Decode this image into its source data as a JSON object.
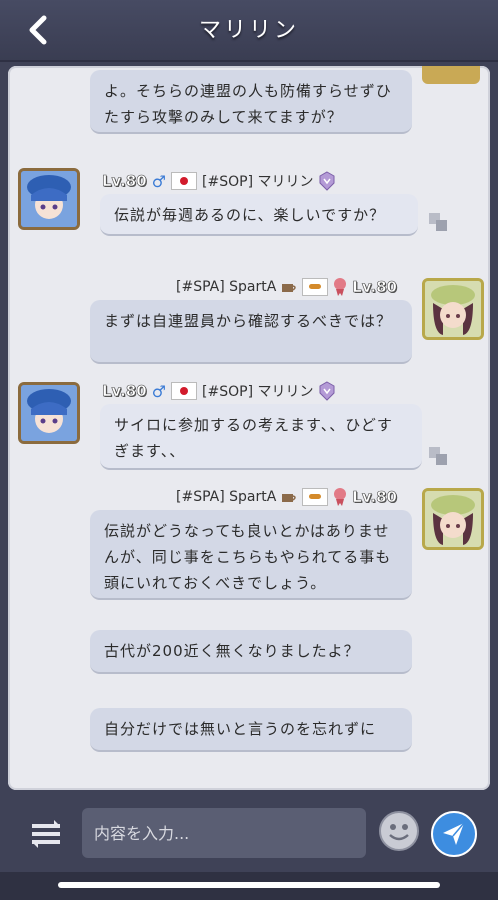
{
  "header": {
    "title": "マリリン"
  },
  "messages": [
    {
      "text": "よ。そちらの連盟の人も防備すらせずひたすら攻撃のみして来てますが？"
    },
    {
      "level": "Lv.80",
      "gender": "♂",
      "name": "[#SOP] マリリン",
      "text": "伝説が毎週あるのに、楽しいですか？"
    },
    {
      "level": "Lv.80",
      "name": "[#SPA] SpartA",
      "text": "まずは自連盟員から確認するべきでは？"
    },
    {
      "level": "Lv.80",
      "gender": "♂",
      "name": "[#SOP] マリリン",
      "text": "サイロに参加するの考えます、、ひどすぎます、、"
    },
    {
      "level": "Lv.80",
      "name": "[#SPA] SpartA",
      "text": "伝説がどうなっても良いとかはありませんが、同じ事をこちらもやられてる事も頭にいれておくべきでしょう。"
    },
    {
      "text": "古代が200近く無くなりましたよ？"
    },
    {
      "text": "自分だけでは無いと言うのを忘れずに"
    }
  ],
  "input": {
    "placeholder": "内容を入力..."
  },
  "icons": {
    "back": "chevron-left-icon",
    "translate": "translate-icon",
    "menu": "switch-channel-icon",
    "emoji": "smiley-icon",
    "send": "paper-plane-icon"
  },
  "colors": {
    "accent": "#3d8de0",
    "header_bg": "#424559",
    "bubble": "#d3d8e6"
  }
}
